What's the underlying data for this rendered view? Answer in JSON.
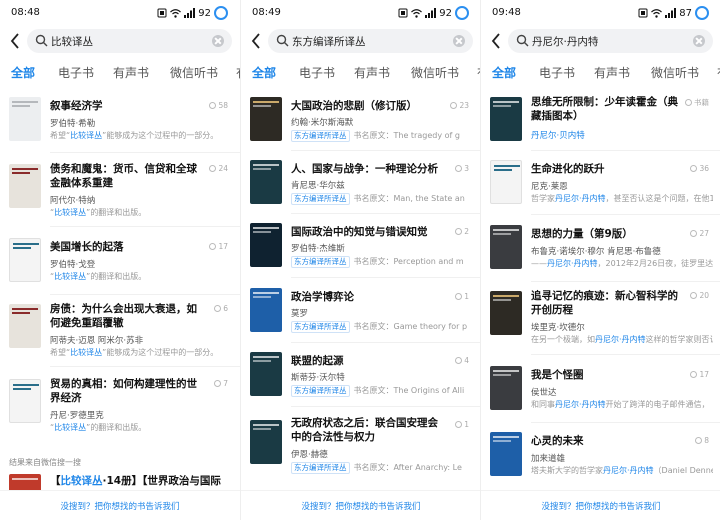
{
  "screens": [
    {
      "time": "08:48",
      "battery": "92",
      "query": "比较译丛",
      "tabs": [
        "全部",
        "电子书",
        "有声书",
        "微信听书",
        "有"
      ],
      "items": [
        {
          "title": "叙事经济学",
          "author": "罗伯特·希勒",
          "desc_prefix": "希望",
          "desc_hl": "比较译丛",
          "desc_suffix": "能够成为这个过程中的一部分。",
          "count": "58",
          "cover": "plain"
        },
        {
          "title": "债务和魔鬼：货币、信贷和全球金融体系重建",
          "author": "阿代尔·特纳",
          "desc_prefix": "",
          "desc_hl": "比较译丛",
          "desc_suffix": "的翻译和出版。",
          "count": "24",
          "cover": "light"
        },
        {
          "title": "美国增长的起落",
          "author": "罗伯特·戈登",
          "desc_prefix": "",
          "desc_hl": "比较译丛",
          "desc_suffix": "的翻译和出版。",
          "count": "17",
          "cover": "white"
        },
        {
          "title": "房债：为什么会出现大衰退，如何避免重蹈覆辙",
          "author": "阿蒂夫·迈恩 阿米尔·苏非",
          "desc_prefix": "希望",
          "desc_hl": "比较译丛",
          "desc_suffix": "能够成为这个过程中的一部分。",
          "count": "6",
          "cover": "light"
        },
        {
          "title": "贸易的真相：如何构建理性的世界经济",
          "author": "丹尼·罗德里克",
          "desc_prefix": "",
          "desc_hl": "比较译丛",
          "desc_suffix": "的翻译和出版。",
          "count": "7",
          "cover": "white"
        }
      ],
      "subhead": "结果来自微信搜一搜",
      "extra_title_prefix": "【",
      "extra_title_hl": "比较译丛",
      "extra_title_suffix": "·14册】【世界政治与国际",
      "bottom_link": "没搜到？把你想找的书告诉我们"
    },
    {
      "time": "08:49",
      "battery": "92",
      "query": "东方编译所译丛",
      "tabs": [
        "全部",
        "电子书",
        "有声书",
        "微信听书",
        "有"
      ],
      "items": [
        {
          "title": "大国政治的悲剧（修订版）",
          "author": "约翰·米尔斯海默",
          "chip": "东方编译所译丛",
          "orig": "书名原文：The tragedy of g",
          "count": "23",
          "cover": "gold"
        },
        {
          "title": "人、国家与战争：一种理论分析",
          "author": "肯尼思·华尔兹",
          "chip": "东方编译所译丛",
          "orig": "书名原文：Man, the State an",
          "count": "3",
          "cover": "teal"
        },
        {
          "title": "国际政治中的知觉与错误知觉",
          "author": "罗伯特·杰维斯",
          "chip": "东方编译所译丛",
          "orig": "书名原文：Perception and m",
          "count": "2",
          "cover": "dark"
        },
        {
          "title": "政治学博弈论",
          "author": "莫罗",
          "chip": "东方编译所译丛",
          "orig": "书名原文：Game theory for p",
          "count": "1",
          "cover": "blue"
        },
        {
          "title": "联盟的起源",
          "author": "斯蒂芬·沃尔特",
          "chip": "东方编译所译丛",
          "orig": "书名原文：The Origins of Alli",
          "count": "4",
          "cover": "teal"
        },
        {
          "title": "无政府状态之后：联合国安理会中的合法性与权力",
          "author": "伊恩·赫德",
          "chip": "东方编译所译丛",
          "orig": "书名原文：After Anarchy: Le",
          "count": "1",
          "cover": "teal"
        }
      ],
      "bottom_link": "没搜到？把你想找的书告诉我们"
    },
    {
      "time": "09:48",
      "battery": "87",
      "query": "丹尼尔·丹内特",
      "tabs": [
        "全部",
        "电子书",
        "有声书",
        "微信听书",
        "有"
      ],
      "items": [
        {
          "title": "思维无所限制：少年读霍金（典藏插图本）",
          "author_hl": "丹尼尔·贝内特",
          "desc": "",
          "count": "书籍",
          "cover": "teal"
        },
        {
          "title": "生命进化的跃升",
          "author": "尼克·莱恩",
          "desc_prefix": "哲学家",
          "desc_hl": "丹尼尔·丹内特",
          "desc_suffix": "，甚至否认这是个问题，在他1",
          "count": "36",
          "cover": "white"
        },
        {
          "title": "思想的力量（第9版）",
          "author": "布鲁克·诺埃尔·穆尔 肯尼思·布鲁德",
          "desc_prefix": "——",
          "desc_hl": "丹尼尔·丹内特",
          "desc_suffix": "，2012年2月26日夜，徒罗里达州",
          "count": "27",
          "cover": "gray"
        },
        {
          "title": "追寻记忆的痕迹：新心智科学的开创历程",
          "author": "埃里克·坎德尔",
          "desc_prefix": "在另一个极端，如",
          "desc_hl": "丹尼尔·丹内特",
          "desc_suffix": "这样的哲学家则否认",
          "count": "20",
          "cover": "gold"
        },
        {
          "title": "我是个怪圈",
          "author": "侯世达",
          "desc_prefix": "和同事",
          "desc_hl": "丹尼尔·丹内特",
          "desc_suffix": "开始了跨洋的电子邮件通信，",
          "count": "17",
          "cover": "gray"
        },
        {
          "title": "心灵的未来",
          "author": "加来道雄",
          "desc_prefix": "塔夫斯大学的哲学家",
          "desc_hl": "丹尼尔·丹内特",
          "desc_suffix": "（Daniel Dennett）",
          "count": "8",
          "cover": "blue"
        }
      ],
      "bottom_link": "没搜到？把你想找的书告诉我们"
    }
  ]
}
